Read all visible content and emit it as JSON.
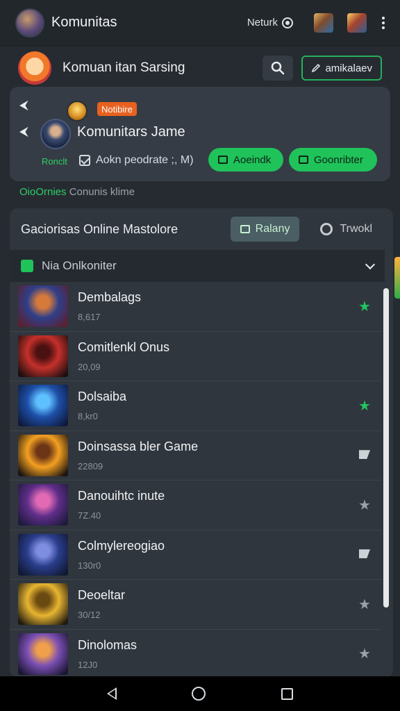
{
  "app": {
    "title": "Komunitas",
    "network_label": "Neturk"
  },
  "profile": {
    "name": "Komuan itan Sarsing",
    "edit_label": "amikalaev"
  },
  "community": {
    "notify_badge": "Notibire",
    "name": "Komunitars Jame",
    "member_label": "Ronclt",
    "checkbox_text": "Aokn peodrate ;, M)",
    "button_one": "Aoeindk",
    "button_two": "Goonribter"
  },
  "status": {
    "green_text": "OioOrnies",
    "rest_text": "Conunis klime"
  },
  "panel": {
    "title": "Gaciorisas Online Mastolore",
    "tab_ranking": "Ralany",
    "tab_tools": "Trwokl",
    "filter_label": "Nia Onlkoniter"
  },
  "games": [
    {
      "title": "Dembalags",
      "sub": "8,617",
      "icon": "star-green",
      "thumb": [
        "#2e3f8a",
        "#d67a3c",
        "#5a2030"
      ]
    },
    {
      "title": "Comitlenkl Onus",
      "sub": "20,09",
      "icon": "none",
      "thumb": [
        "#c4302a",
        "#4b1010",
        "#1b0f10"
      ]
    },
    {
      "title": "Dolsaiba",
      "sub": "8,kr0",
      "icon": "star-green",
      "thumb": [
        "#1e4fa8",
        "#5fc0ff",
        "#0e1a3c"
      ]
    },
    {
      "title": "Doinsassa bler Game",
      "sub": "22809",
      "icon": "flag",
      "thumb": [
        "#f3a021",
        "#6b3516",
        "#1c1410"
      ]
    },
    {
      "title": "Danouihtc inute",
      "sub": "7Z.40",
      "icon": "star-gray",
      "thumb": [
        "#5f2e8a",
        "#e26ab4",
        "#1e1a3c"
      ]
    },
    {
      "title": "Colmylereogiao",
      "sub": "130r0",
      "icon": "flag",
      "thumb": [
        "#2a3d8c",
        "#7e8de0",
        "#101830"
      ]
    },
    {
      "title": "Deoeltar",
      "sub": "30/12",
      "icon": "star-gray",
      "thumb": [
        "#e8b531",
        "#6b4a12",
        "#1f1a10"
      ]
    },
    {
      "title": "Dinolomas",
      "sub": "12J0",
      "icon": "star-gray",
      "thumb": [
        "#7b4fb5",
        "#f0a04a",
        "#1a1630"
      ]
    }
  ],
  "colors": {
    "accent": "#1fc35a",
    "background": "#262b31",
    "card": "#353c45",
    "badge": "#e8611f"
  }
}
